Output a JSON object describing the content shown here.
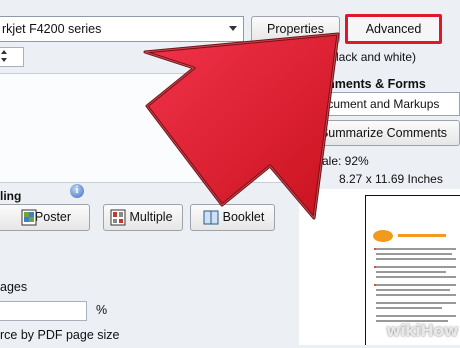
{
  "printer": {
    "name_fragment": "rkjet F4200 series"
  },
  "buttons": {
    "properties": "Properties",
    "advanced": "Advanced"
  },
  "sizing": {
    "header": "ling",
    "info_icon": "i",
    "modes": [
      {
        "label": "Poster"
      },
      {
        "label": "Multiple"
      },
      {
        "label": "Booklet"
      }
    ]
  },
  "scale": {
    "pages_label": "ages",
    "percent_sign": "%",
    "choose_source_label": "rce by PDF page size"
  },
  "right": {
    "grayscale_label": "ale (black and white)",
    "comments_forms_header": "Comments & Forms",
    "comments_forms_value": "Document and Markups",
    "summarize_button": "Summarize Comments",
    "scale_label": "Scale:  92%",
    "page_dimensions": "8.27 x 11.69 Inches"
  },
  "watermark": "wikiHow",
  "colors": {
    "accent_red": "#e0162b",
    "arrow_fill": "#e8253a"
  }
}
